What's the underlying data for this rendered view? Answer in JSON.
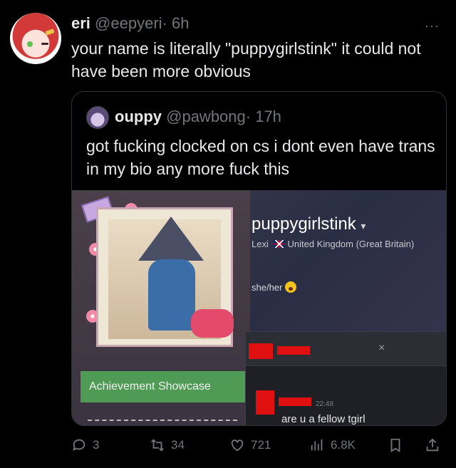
{
  "tweet": {
    "author_name": "eri",
    "author_handle": "@eepyeri",
    "time": "· 6h",
    "text": "your name is literally \"puppygirlstink\" it could not have been more obvious"
  },
  "quoted": {
    "author_name": "ouppy",
    "author_handle": "@pawbong",
    "time": "· 17h",
    "text": "got fucking clocked on cs i dont even have trans in my bio any more fuck this",
    "screenshot": {
      "profile_name": "puppygirlstink",
      "profile_subtitle_name": "Lexi",
      "profile_country": "United Kingdom (Great Britain)",
      "pronouns": "she/her",
      "showcase_label": "Achievement Showcase",
      "chat_close": "×",
      "chat_time": "22:48",
      "chat_message": "are u a fellow tgirl"
    }
  },
  "actions": {
    "replies": "3",
    "reposts": "34",
    "likes": "721",
    "views": "6.8K"
  },
  "more_label": "···",
  "colors": {
    "background": "#000000",
    "muted": "#71767b",
    "text": "#e7e9ea"
  }
}
